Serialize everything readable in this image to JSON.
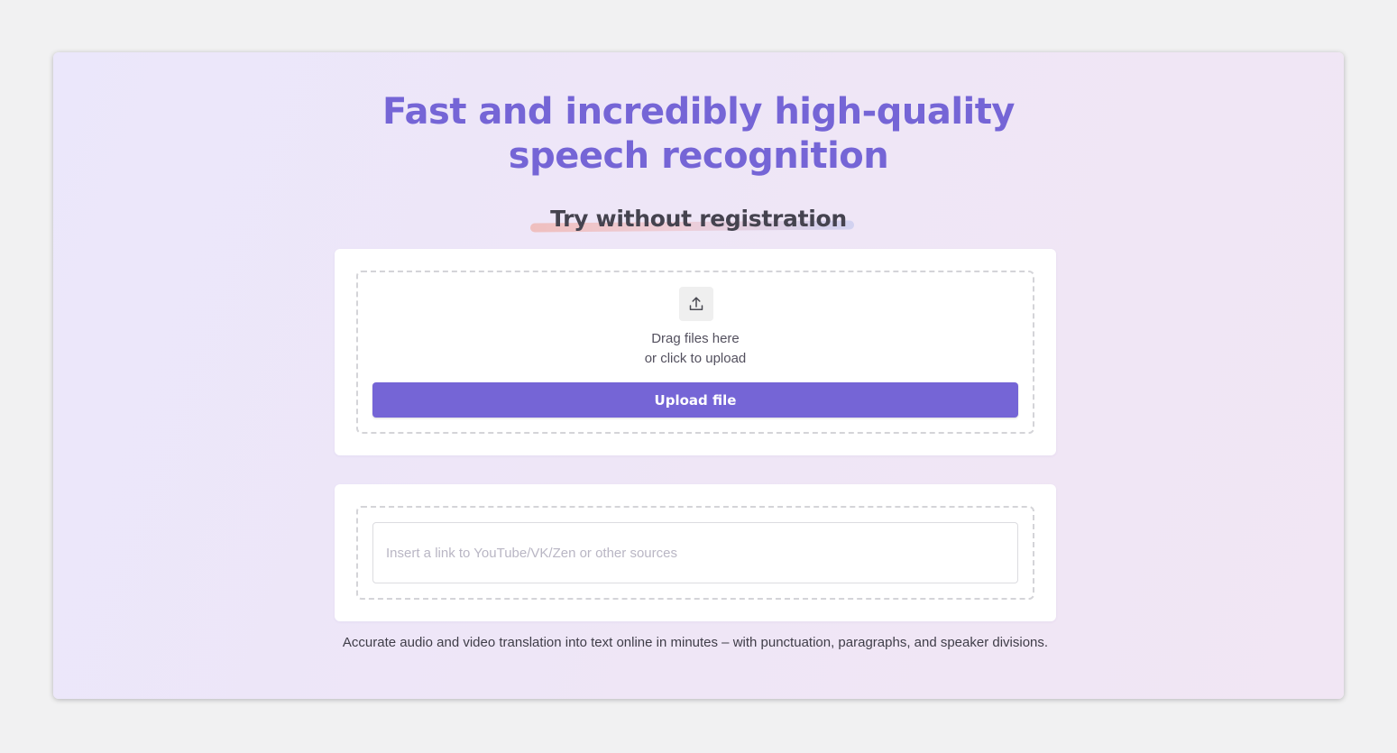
{
  "hero": {
    "title_line1": "Fast and incredibly high-quality",
    "title_line2": "speech recognition",
    "subtitle": "Try without registration",
    "description": "Accurate audio and video translation into text online in minutes – with punctuation, paragraphs, and speaker divisions."
  },
  "upload": {
    "icon": "upload-icon",
    "drag_text": "Drag files here",
    "click_text": "or click to upload",
    "button_label": "Upload file"
  },
  "link_input": {
    "value": "",
    "placeholder": "Insert a link to YouTube/VK/Zen or other sources"
  },
  "colors": {
    "accent": "#7565d6",
    "heading_dark": "#45434f",
    "page_background": "#f1f1f2",
    "card_background": "#ffffff"
  }
}
